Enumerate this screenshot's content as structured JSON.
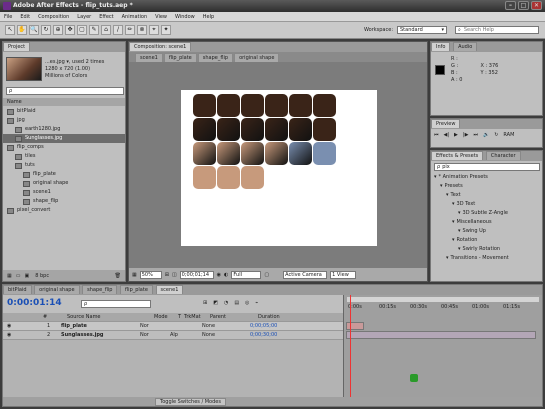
{
  "window": {
    "title": "Adobe After Effects - flip_tuts.aep *",
    "minimize": "–",
    "maximize": "□",
    "close": "✕"
  },
  "menu": [
    "File",
    "Edit",
    "Composition",
    "Layer",
    "Effect",
    "Animation",
    "View",
    "Window",
    "Help"
  ],
  "toolbar": {
    "tools": [
      "↖",
      "✋",
      "🔍",
      "↻",
      "⊕",
      "✥",
      "▢",
      "✎",
      "⌂",
      "/",
      "✏",
      "⊗",
      "⌖",
      "✦"
    ],
    "workspace_label": "Workspace:",
    "workspace_value": "Standard",
    "search_placeholder": "Search Help"
  },
  "project": {
    "tab": "Project",
    "selected_name": "...es.jpg ▾, used 2 times",
    "selected_dims": "1280 x 720 (1.00)",
    "selected_colors": "Millions of Colors",
    "search_placeholder": "ρ",
    "column_name": "Name",
    "items": [
      {
        "label": "bitPlaid",
        "indent": 0,
        "selected": false
      },
      {
        "label": "jpg",
        "indent": 0,
        "selected": false
      },
      {
        "label": "earth1280.jpg",
        "indent": 1,
        "selected": false
      },
      {
        "label": "Sunglasses.jpg",
        "indent": 1,
        "selected": true
      },
      {
        "label": "flip_comps",
        "indent": 0,
        "selected": false
      },
      {
        "label": "tiles",
        "indent": 1,
        "selected": false
      },
      {
        "label": "tuts",
        "indent": 1,
        "selected": false
      },
      {
        "label": "flip_plate",
        "indent": 2,
        "selected": false
      },
      {
        "label": "original shape",
        "indent": 2,
        "selected": false
      },
      {
        "label": "scene1",
        "indent": 2,
        "selected": false
      },
      {
        "label": "shape_flip",
        "indent": 2,
        "selected": false
      },
      {
        "label": "pixel_convert",
        "indent": 0,
        "selected": false
      }
    ],
    "bpc": "8 bpc"
  },
  "composition": {
    "tab": "Composition: scene1",
    "breadcrumbs": [
      "scene1",
      "flip_plate",
      "shape_flip",
      "original shape"
    ],
    "zoom": "50%",
    "timecode": "0;00;01;14",
    "resolution": "Full",
    "camera": "Active Camera",
    "views": "1 View"
  },
  "info": {
    "tabs": [
      "Info",
      "Audio"
    ],
    "r": "R :",
    "g": "G :",
    "b": "B :",
    "a": "A : 0",
    "x": "X : 376",
    "y": "Y : 352"
  },
  "preview": {
    "tab": "Preview",
    "controls": [
      "⏮",
      "◀|",
      "▶",
      "|▶",
      "⏭",
      "🔊",
      "↻",
      "RAM"
    ]
  },
  "effects": {
    "tabs": [
      "Effects & Presets",
      "Character"
    ],
    "search_value": "pix",
    "items": [
      {
        "label": "* Animation Presets",
        "indent": 0
      },
      {
        "label": "Presets",
        "indent": 1
      },
      {
        "label": "Text",
        "indent": 2
      },
      {
        "label": "3D Text",
        "indent": 3
      },
      {
        "label": "3D Subtle Z-Angle",
        "indent": 4
      },
      {
        "label": "Miscellaneous",
        "indent": 3
      },
      {
        "label": "Swing Up",
        "indent": 4
      },
      {
        "label": "Rotation",
        "indent": 3
      },
      {
        "label": "Swirly Rotation",
        "indent": 4
      },
      {
        "label": "Transitions - Movement",
        "indent": 2
      }
    ]
  },
  "timeline": {
    "tabs": [
      "bitPlaid",
      "original shape",
      "shape_flip",
      "flip_plate",
      "scene1"
    ],
    "timecode": "0:00:01:14",
    "search_placeholder": "ρ",
    "headers": [
      "#",
      "Source Name",
      "Mode",
      "T",
      "TrkMat",
      "Parent",
      "Duration"
    ],
    "ruler": [
      "0:00s",
      "00:15s",
      "00:30s",
      "00:45s",
      "01:00s",
      "01:15s"
    ],
    "layers": [
      {
        "num": "1",
        "name": "flip_plate",
        "mode": "Nor",
        "trkmat": "",
        "parent": "None",
        "duration": "0;00;05;00"
      },
      {
        "num": "2",
        "name": "Sunglasses.jpg",
        "mode": "Nor",
        "trkmat": "Alp",
        "parent": "None",
        "duration": "0;00;30;00"
      }
    ],
    "footer": "Toggle Switches / Modes"
  }
}
